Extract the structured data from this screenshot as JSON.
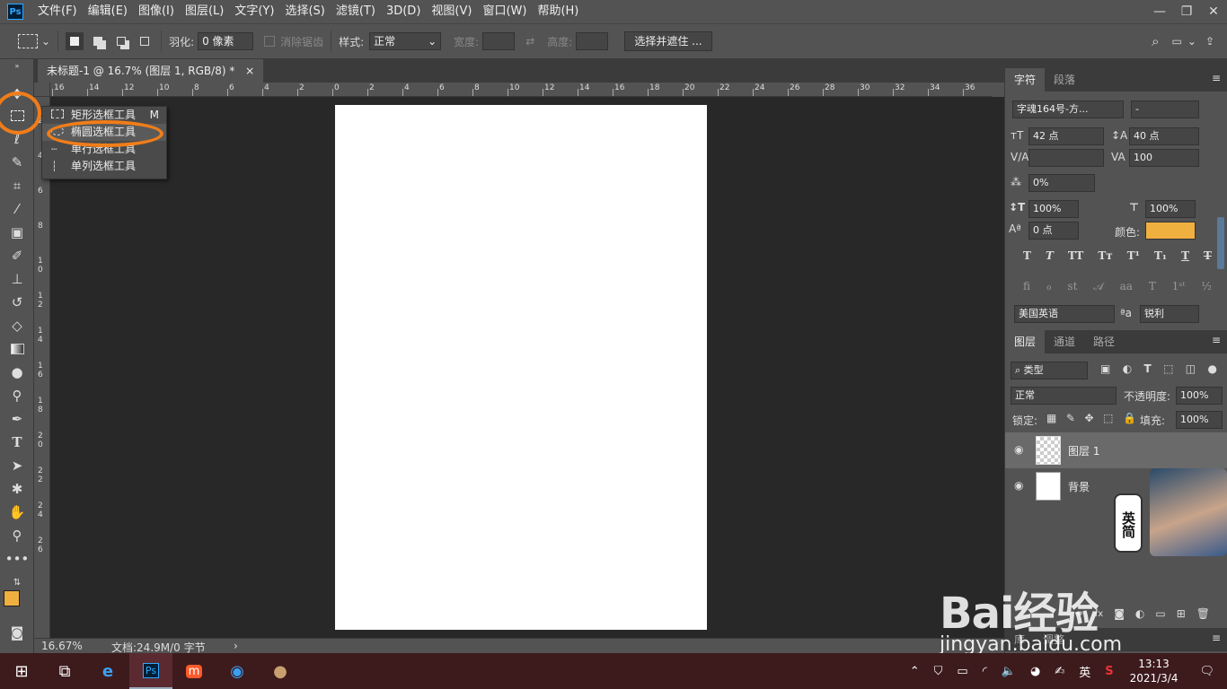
{
  "app": {
    "logo": "Ps"
  },
  "menu": [
    "文件(F)",
    "编辑(E)",
    "图像(I)",
    "图层(L)",
    "文字(Y)",
    "选择(S)",
    "滤镜(T)",
    "3D(D)",
    "视图(V)",
    "窗口(W)",
    "帮助(H)"
  ],
  "options": {
    "feather_label": "羽化:",
    "feather_value": "0 像素",
    "antialias": "消除锯齿",
    "style_label": "样式:",
    "style_value": "正常",
    "width_label": "宽度:",
    "height_label": "高度:",
    "select_mask_button": "选择并遮住 ..."
  },
  "document": {
    "tab_title": "未标题-1 @ 16.7% (图层 1, RGB/8) *",
    "close": "×"
  },
  "ruler_h": [
    "16",
    "14",
    "12",
    "10",
    "8",
    "6",
    "4",
    "2",
    "0",
    "2",
    "4",
    "6",
    "8",
    "10",
    "12",
    "14",
    "16",
    "18",
    "20",
    "22",
    "24",
    "26",
    "28",
    "30",
    "32",
    "34",
    "36"
  ],
  "ruler_v": [
    "2",
    "4",
    "6",
    "8",
    "1\n0",
    "1\n2",
    "1\n4",
    "1\n6",
    "1\n8",
    "2\n0",
    "2\n2",
    "2\n4",
    "2\n6"
  ],
  "flyout": {
    "items": [
      {
        "label": "矩形选框工具",
        "shortcut": "M",
        "icon": "rect-marquee-icon"
      },
      {
        "label": "椭圆选框工具",
        "shortcut": "",
        "icon": "ellipse-marquee-icon"
      },
      {
        "label": "单行选框工具",
        "shortcut": "",
        "icon": "single-row-icon"
      },
      {
        "label": "单列选框工具",
        "shortcut": "",
        "icon": "single-column-icon"
      }
    ]
  },
  "status": {
    "zoom": "16.67%",
    "doc_info": "文档:24.9M/0 字节"
  },
  "character_panel": {
    "tabs": [
      "字符",
      "段落"
    ],
    "font_family": "字魂164号-方...",
    "font_style": "-",
    "font_size": "42 点",
    "leading": "40 点",
    "kerning": "",
    "tracking": "100",
    "scale_percent": "0%",
    "vertical_scale": "100%",
    "horizontal_scale": "100%",
    "baseline_shift": "0 点",
    "color_label": "颜色:",
    "color": "#f0b040",
    "language": "美国英语",
    "antialias": "锐利",
    "aa_label": "ªa"
  },
  "layers_panel": {
    "tabs": [
      "图层",
      "通道",
      "路径"
    ],
    "filter": "类型",
    "blend_mode": "正常",
    "opacity_label": "不透明度:",
    "opacity": "100%",
    "lock_label": "锁定:",
    "fill_label": "填充:",
    "fill": "100%",
    "layers": [
      {
        "name": "图层 1",
        "selected": true
      },
      {
        "name": "背景",
        "selected": false
      }
    ],
    "bottom_tabs": [
      "库",
      "调整"
    ]
  },
  "overlay": {
    "ime_text": "英简",
    "watermark": "Bai经验",
    "watermark_url": "jingyan.baidu.com"
  },
  "taskbar": {
    "time": "13:13",
    "date": "2021/3/4",
    "ime": "英"
  },
  "colors": {
    "foreground": "#f0b040",
    "background": "#c8a080",
    "highlight": "#f07d1a"
  }
}
